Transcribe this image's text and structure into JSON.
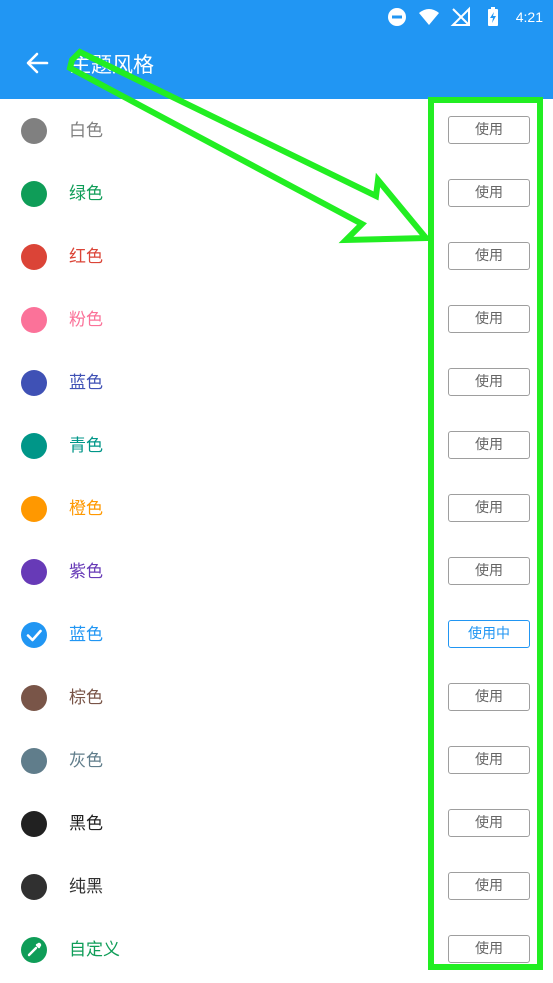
{
  "status_bar": {
    "time": "4:21"
  },
  "header": {
    "title": "主题风格",
    "back_icon": "arrow-left-icon"
  },
  "themes": [
    {
      "label": "白色",
      "color": "#808080",
      "button": "使用",
      "active": false,
      "icon": ""
    },
    {
      "label": "绿色",
      "color": "#0f9d58",
      "button": "使用",
      "active": false,
      "icon": ""
    },
    {
      "label": "红色",
      "color": "#db4437",
      "button": "使用",
      "active": false,
      "icon": ""
    },
    {
      "label": "粉色",
      "color": "#fb7299",
      "button": "使用",
      "active": false,
      "icon": ""
    },
    {
      "label": "蓝色",
      "color": "#3f51b5",
      "button": "使用",
      "active": false,
      "icon": ""
    },
    {
      "label": "青色",
      "color": "#009688",
      "button": "使用",
      "active": false,
      "icon": ""
    },
    {
      "label": "橙色",
      "color": "#ff9800",
      "button": "使用",
      "active": false,
      "icon": ""
    },
    {
      "label": "紫色",
      "color": "#673ab7",
      "button": "使用",
      "active": false,
      "icon": ""
    },
    {
      "label": "蓝色",
      "color": "#2196f3",
      "button": "使用中",
      "active": true,
      "icon": "check-icon"
    },
    {
      "label": "棕色",
      "color": "#795548",
      "button": "使用",
      "active": false,
      "icon": ""
    },
    {
      "label": "灰色",
      "color": "#607d8b",
      "button": "使用",
      "active": false,
      "icon": ""
    },
    {
      "label": "黑色",
      "color": "#212121",
      "button": "使用",
      "active": false,
      "icon": ""
    },
    {
      "label": "纯黑",
      "color": "#303030",
      "button": "使用",
      "active": false,
      "icon": ""
    },
    {
      "label": "自定义",
      "color": "#0f9d58",
      "button": "使用",
      "active": false,
      "icon": "eyedropper-icon"
    }
  ],
  "colors": {
    "app_bar": "#2196f3",
    "annotation": "#22ee22",
    "active_button": "#2196f3"
  }
}
